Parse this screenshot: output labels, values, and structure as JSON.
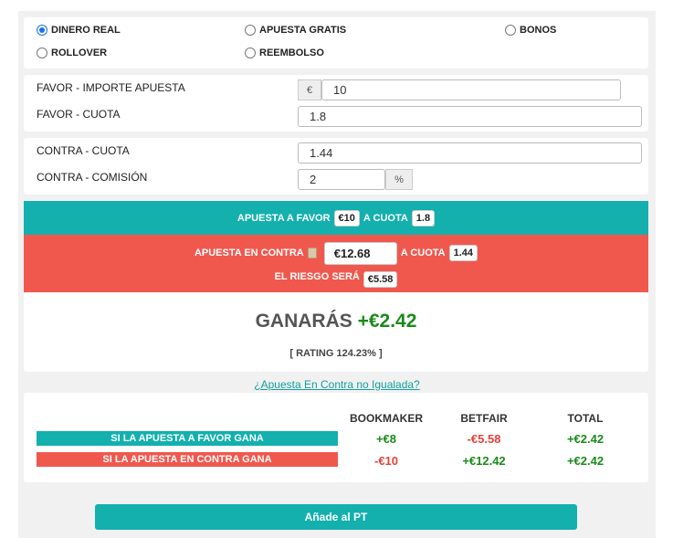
{
  "modes": [
    {
      "label": "DINERO REAL",
      "selected": true
    },
    {
      "label": "APUESTA GRATIS",
      "selected": false
    },
    {
      "label": "BONOS",
      "selected": false
    },
    {
      "label": "ROLLOVER",
      "selected": false
    },
    {
      "label": "REEMBOLSO",
      "selected": false
    }
  ],
  "favor": {
    "stake_label": "FAVOR - IMPORTE APUESTA",
    "currency": "€",
    "stake_value": "10",
    "odds_label": "FAVOR - CUOTA",
    "odds_value": "1.8"
  },
  "contra": {
    "odds_label": "CONTRA - CUOTA",
    "odds_value": "1.44",
    "commission_label": "CONTRA - COMISIÓN",
    "commission_value": "2",
    "percent": "%"
  },
  "summary": {
    "favor_text": "APUESTA A FAVOR",
    "favor_amount": "€10",
    "favor_odds_text": "A CUOTA",
    "favor_odds": "1.8",
    "contra_text": "APUESTA EN CONTRA",
    "contra_amount": "€12.68",
    "contra_odds_text": "A CUOTA",
    "contra_odds": "1.44",
    "risk_text": "EL RIESGO SERÁ",
    "risk_amount": "€5.58"
  },
  "result": {
    "win_text": "GANARÁS",
    "win_amount": "+€2.42",
    "rating": "[ RATING 124.23% ]"
  },
  "unmatched_link": "¿Apuesta En Contra no Igualada?",
  "table": {
    "headers": [
      "BOOKMAKER",
      "BETFAIR",
      "TOTAL"
    ],
    "rows": [
      {
        "label": "SI LA APUESTA A FAVOR GANA",
        "bookmaker": "+€8",
        "betfair": "-€5.58",
        "total": "+€2.42"
      },
      {
        "label": "SI LA APUESTA EN CONTRA GANA",
        "bookmaker": "-€10",
        "betfair": "+€12.42",
        "total": "+€2.42"
      }
    ]
  },
  "add_button": "Añade al PT",
  "colors": {
    "teal": "#13b0ae",
    "red": "#f0584e",
    "green": "#1a8a1a",
    "negative": "#e0443a"
  }
}
